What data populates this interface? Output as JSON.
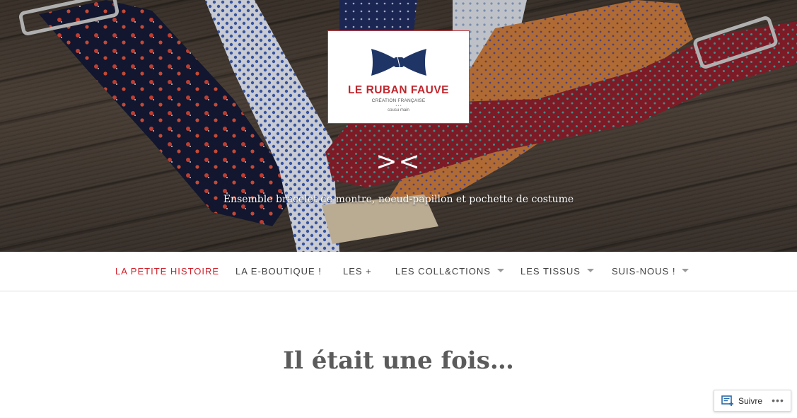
{
  "hero": {
    "logo": {
      "name": "LE RUBAN FAUVE",
      "subtitle": "CRÉATION FRANÇAISE",
      "dots": "• • •",
      "subtitle2": "cousu main"
    },
    "site_mark": "><",
    "tagline": "Ensemble bracelet de montre, noeud-papillon et pochette de costume"
  },
  "nav": {
    "items": [
      {
        "label": "LA PETITE HISTOIRE",
        "active": true,
        "has_dropdown": false
      },
      {
        "label": "LA E-BOUTIQUE !",
        "active": false,
        "has_dropdown": false
      },
      {
        "label": "LES +",
        "active": false,
        "has_dropdown": false
      },
      {
        "label": "LES COLL&CTIONS",
        "active": false,
        "has_dropdown": true
      },
      {
        "label": "LES TISSUS",
        "active": false,
        "has_dropdown": true
      },
      {
        "label": "SUIS-NOUS !",
        "active": false,
        "has_dropdown": true
      }
    ]
  },
  "main": {
    "title": "Il était une fois…"
  },
  "follow": {
    "label": "Suivre",
    "icon": "reader-follow-icon",
    "more_icon": "more-dots-icon"
  },
  "colors": {
    "accent": "#d0202a",
    "logo_red": "#c0262d",
    "bow_navy": "#1f3566",
    "nav_text": "#404040",
    "title_text": "#5b5b5b"
  }
}
